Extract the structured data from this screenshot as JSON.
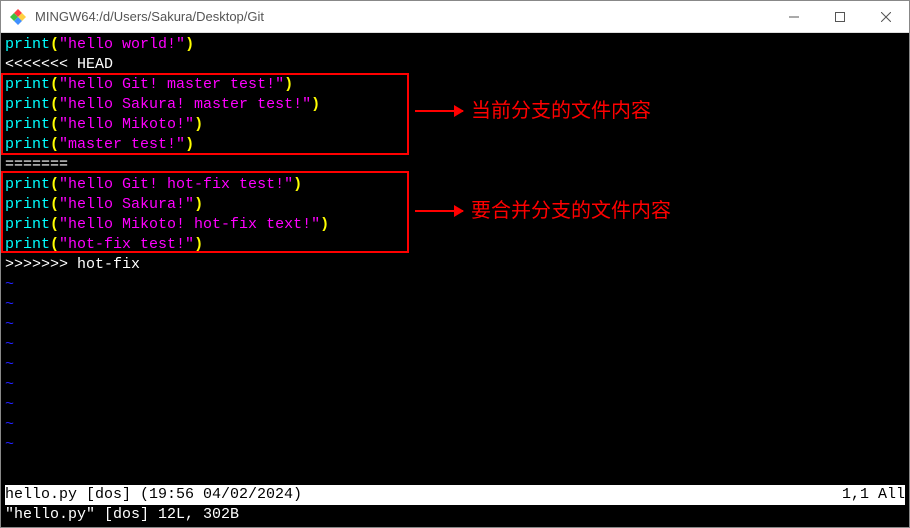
{
  "window": {
    "title": "MINGW64:/d/Users/Sakura/Desktop/Git"
  },
  "editor": {
    "lines": {
      "l0_func": "print",
      "l0_po": "(",
      "l0_str": "\"hello world!\"",
      "l0_pc": ")",
      "marker_head": "<<<<<<< HEAD",
      "l2_func": "print",
      "l2_po": "(",
      "l2_str": "\"hello Git! master test!\"",
      "l2_pc": ")",
      "l3_func": "print",
      "l3_po": "(",
      "l3_str": "\"hello Sakura! master test!\"",
      "l3_pc": ")",
      "l4_func": "print",
      "l4_po": "(",
      "l4_str": "\"hello Mikoto!\"",
      "l4_pc": ")",
      "l5_func": "print",
      "l5_po": "(",
      "l5_str": "\"master test!\"",
      "l5_pc": ")",
      "marker_sep": "=======",
      "l7_func": "print",
      "l7_po": "(",
      "l7_str": "\"hello Git! hot-fix test!\"",
      "l7_pc": ")",
      "l8_func": "print",
      "l8_po": "(",
      "l8_str": "\"hello Sakura!\"",
      "l8_pc": ")",
      "l9_func": "print",
      "l9_po": "(",
      "l9_str": "\"hello Mikoto! hot-fix text!\"",
      "l9_pc": ")",
      "l10_func": "print",
      "l10_po": "(",
      "l10_str": "\"hot-fix test!\"",
      "l10_pc": ")",
      "marker_end": ">>>>>>> hot-fix",
      "tilde": "~"
    }
  },
  "annotations": {
    "current_branch_label": "当前分支的文件内容",
    "merge_branch_label": "要合并分支的文件内容"
  },
  "status": {
    "left": "hello.py [dos] (19:56 04/02/2024)",
    "right": "1,1 All"
  },
  "cmdline": "\"hello.py\" [dos] 12L, 302B"
}
